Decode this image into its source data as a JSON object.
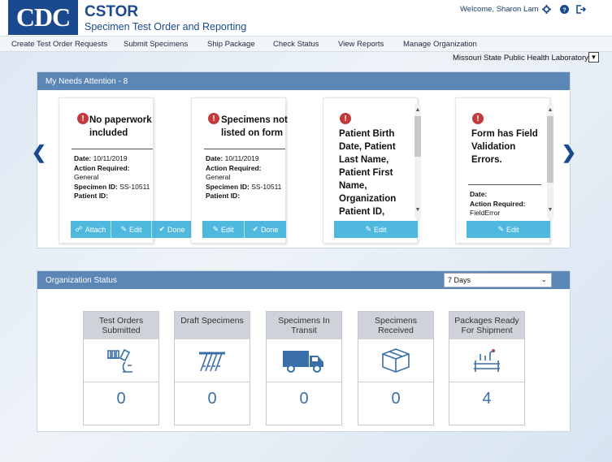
{
  "header": {
    "logo_text": "CDC",
    "title": "CSTOR",
    "subtitle": "Specimen Test Order and Reporting",
    "welcome": "Welcome, Sharon Lam"
  },
  "nav": {
    "items": [
      "Create Test Order Requests",
      "Submit Specimens",
      "Ship Package",
      "Check Status",
      "View Reports",
      "Manage Organization"
    ]
  },
  "org_select": {
    "value": "Missouri State Public Health Laboratory"
  },
  "needs_attention": {
    "title": "My Needs Attention - 8",
    "cards": [
      {
        "title": "No paperwork included",
        "date_label": "Date:",
        "date": "10/11/2019",
        "action_label": "Action Required:",
        "action": "General",
        "specimen_label": "Specimen ID:",
        "specimen": "SS-10511",
        "patient_label": "Patient ID:",
        "buttons": [
          "Attach",
          "Edit",
          "Done"
        ]
      },
      {
        "title": "Specimens not listed on form",
        "date_label": "Date:",
        "date": "10/11/2019",
        "action_label": "Action Required:",
        "action": "General",
        "specimen_label": "Specimen ID:",
        "specimen": "SS-10511",
        "patient_label": "Patient ID:",
        "buttons": [
          "Edit",
          "Done"
        ]
      },
      {
        "title": "Patient Birth Date, Patient Last Name, Patient First Name, Organization Patient ID,",
        "buttons": [
          "Edit"
        ]
      },
      {
        "title": "Form has Field Validation Errors.",
        "date_label": "Date:",
        "action_label": "Action Required:",
        "action": "FieldError",
        "buttons": [
          "Edit"
        ]
      }
    ]
  },
  "org_status": {
    "title": "Organization Status",
    "range": "7 Days",
    "tiles": [
      {
        "label": "Test Orders Submitted",
        "count": "0",
        "icon": "microscope-icon"
      },
      {
        "label": "Draft Specimens",
        "count": "0",
        "icon": "test-tubes-icon"
      },
      {
        "label": "Specimens In Transit",
        "count": "0",
        "icon": "truck-icon"
      },
      {
        "label": "Specimens Received",
        "count": "0",
        "icon": "box-icon"
      },
      {
        "label": "Packages Ready For Shipment",
        "count": "4",
        "icon": "lab-rack-icon"
      }
    ]
  },
  "colors": {
    "brand": "#1a4a8d",
    "panel_header": "#5b86b5",
    "button": "#4fb8df",
    "alert": "#c23a3a",
    "count": "#3a6fa8"
  }
}
